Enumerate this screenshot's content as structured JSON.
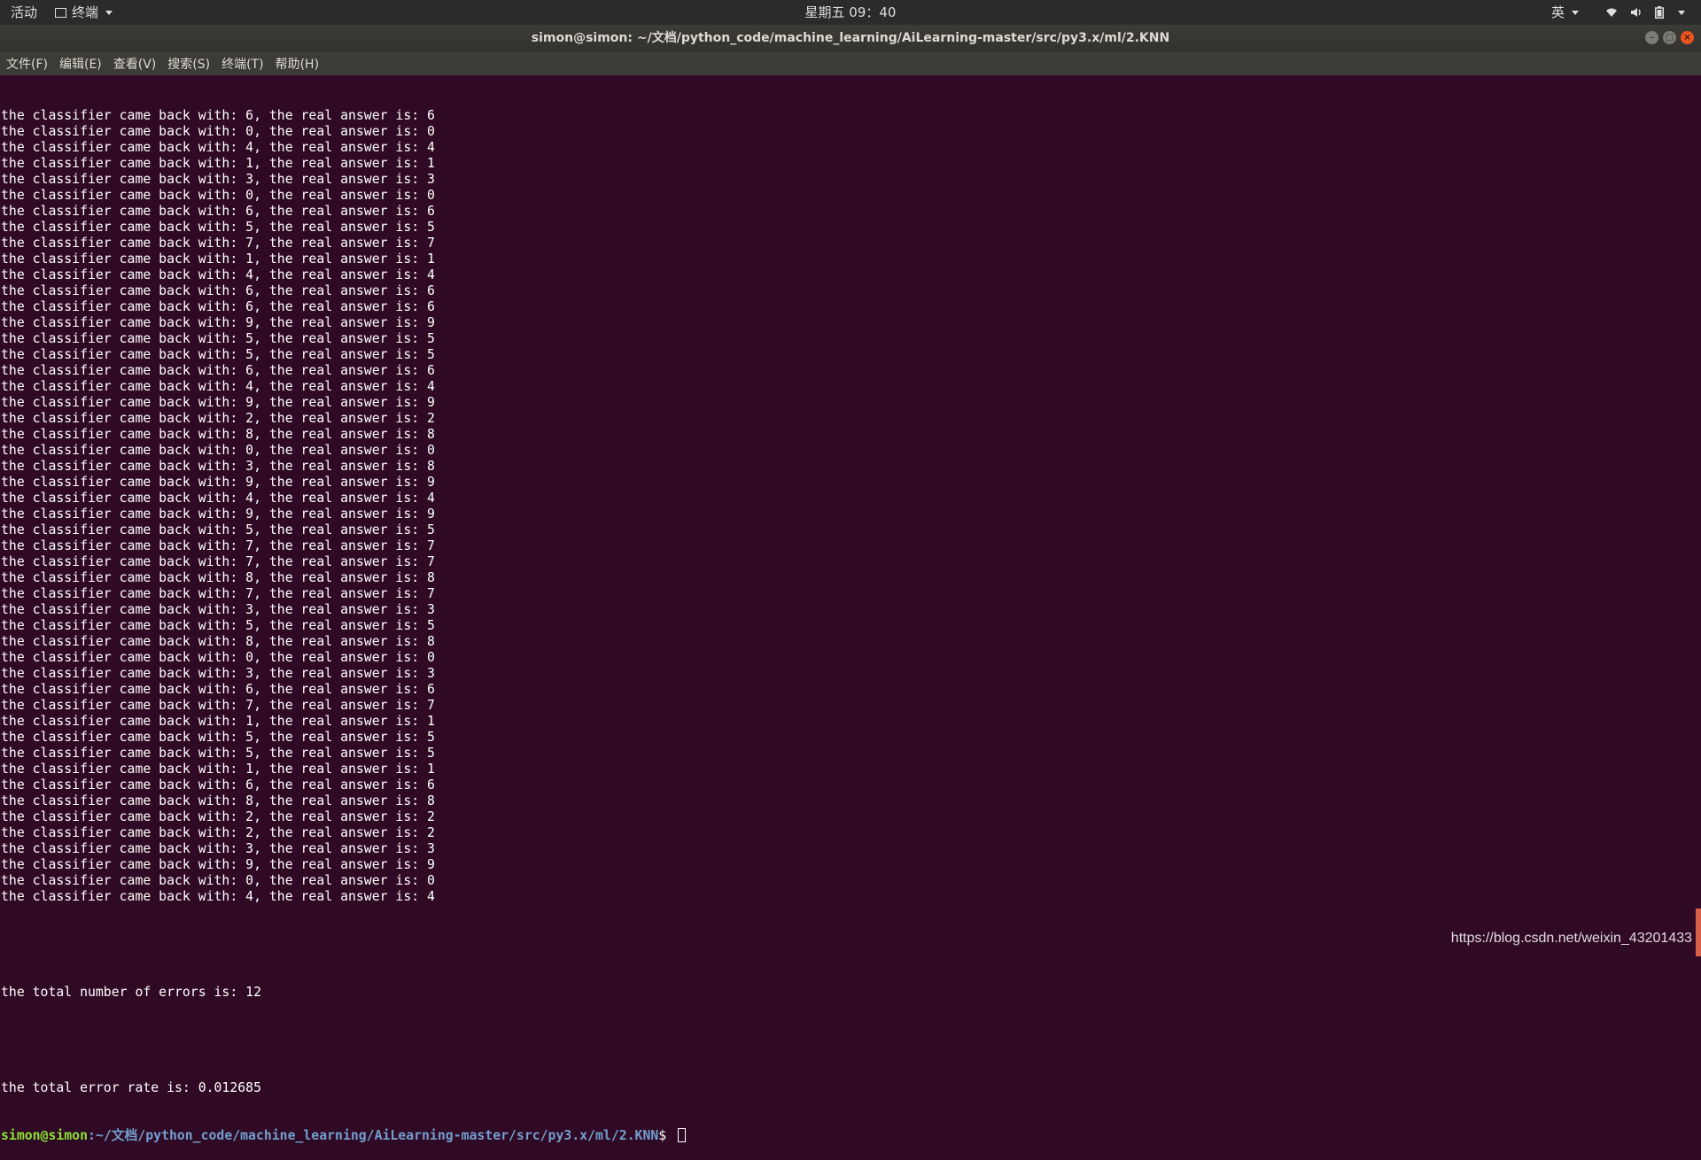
{
  "topbar": {
    "activities": "活动",
    "app_name": "终端",
    "clock": "星期五 09：40",
    "input_method": "英",
    "icons": [
      "wifi-icon",
      "volume-icon",
      "battery-icon",
      "system-menu-caret"
    ]
  },
  "window": {
    "title": "simon@simon: ~/文档/python_code/machine_learning/AiLearning-master/src/py3.x/ml/2.KNN"
  },
  "menubar": {
    "items": [
      "文件(F)",
      "编辑(E)",
      "查看(V)",
      "搜索(S)",
      "终端(T)",
      "帮助(H)"
    ]
  },
  "terminal": {
    "line_template": "the classifier came back with: {p}, the real answer is: {r}",
    "results": [
      [
        6,
        6
      ],
      [
        0,
        0
      ],
      [
        4,
        4
      ],
      [
        1,
        1
      ],
      [
        3,
        3
      ],
      [
        0,
        0
      ],
      [
        6,
        6
      ],
      [
        5,
        5
      ],
      [
        7,
        7
      ],
      [
        1,
        1
      ],
      [
        4,
        4
      ],
      [
        6,
        6
      ],
      [
        6,
        6
      ],
      [
        9,
        9
      ],
      [
        5,
        5
      ],
      [
        5,
        5
      ],
      [
        6,
        6
      ],
      [
        4,
        4
      ],
      [
        9,
        9
      ],
      [
        2,
        2
      ],
      [
        8,
        8
      ],
      [
        0,
        0
      ],
      [
        3,
        8
      ],
      [
        9,
        9
      ],
      [
        4,
        4
      ],
      [
        9,
        9
      ],
      [
        5,
        5
      ],
      [
        7,
        7
      ],
      [
        7,
        7
      ],
      [
        8,
        8
      ],
      [
        7,
        7
      ],
      [
        3,
        3
      ],
      [
        5,
        5
      ],
      [
        8,
        8
      ],
      [
        0,
        0
      ],
      [
        3,
        3
      ],
      [
        6,
        6
      ],
      [
        7,
        7
      ],
      [
        1,
        1
      ],
      [
        5,
        5
      ],
      [
        5,
        5
      ],
      [
        1,
        1
      ],
      [
        6,
        6
      ],
      [
        8,
        8
      ],
      [
        2,
        2
      ],
      [
        2,
        2
      ],
      [
        3,
        3
      ],
      [
        9,
        9
      ],
      [
        0,
        0
      ],
      [
        4,
        4
      ]
    ],
    "total_errors": "the total number of errors is: 12",
    "error_rate": "the total error rate is: 0.012685",
    "prompt_user": "simon@simon",
    "prompt_path": ":~/文档/python_code/machine_learning/AiLearning-master/src/py3.x/ml/2.KNN",
    "prompt_symbol": "$ "
  },
  "watermark": "https://blog.csdn.net/weixin_43201433",
  "colors": {
    "terminal_bg": "#300a24",
    "prompt_user": "#8ae234",
    "prompt_path": "#729fcf",
    "close_button": "#e9541f"
  }
}
